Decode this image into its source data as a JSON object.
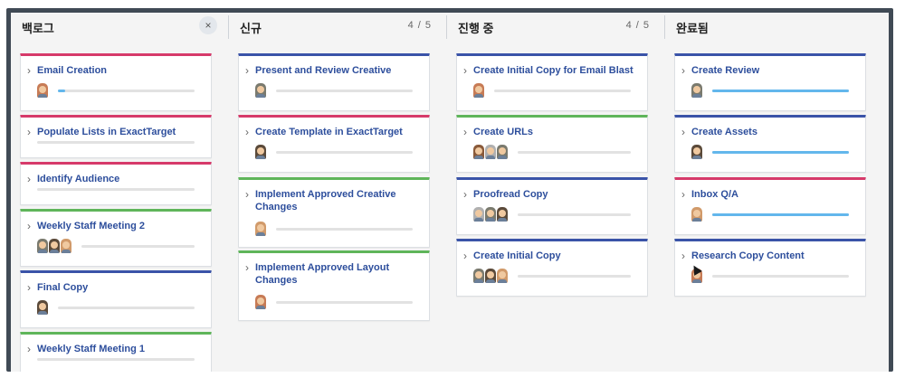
{
  "colors": {
    "pink": "#d63a6a",
    "blue": "#3a53a8",
    "green": "#5fb55a",
    "progress_fill": "#63b7ec",
    "title_text": "#2d4e9c"
  },
  "columns": [
    {
      "title": "백로그",
      "count": "",
      "close_icon": "×",
      "cards": [
        {
          "title": "Email Creation",
          "color": "pink",
          "avatars": [
            "person"
          ],
          "progress": 0.05
        },
        {
          "title": "Populate Lists in ExactTarget",
          "color": "pink",
          "avatars": [],
          "progress": 0
        },
        {
          "title": "Identify Audience",
          "color": "pink",
          "avatars": [],
          "progress": 0
        },
        {
          "title": "Weekly Staff Meeting 2",
          "color": "green",
          "avatars": [
            "person",
            "person",
            "person"
          ],
          "progress": 0
        },
        {
          "title": "Final Copy",
          "color": "blue",
          "avatars": [
            "person"
          ],
          "progress": 0
        },
        {
          "title": "Weekly Staff Meeting 1",
          "color": "green",
          "avatars": [],
          "progress": 0
        }
      ]
    },
    {
      "title": "신규",
      "count": "4 / 5",
      "cards": [
        {
          "title": "Present and Review Creative",
          "color": "blue",
          "avatars": [
            "person"
          ],
          "progress": 0
        },
        {
          "title": "Create Template in ExactTarget",
          "color": "pink",
          "avatars": [
            "person"
          ],
          "progress": 0
        },
        {
          "title": "Implement Approved Creative Changes",
          "color": "green",
          "avatars": [
            "person"
          ],
          "progress": 0
        },
        {
          "title": "Implement Approved Layout Changes",
          "color": "green",
          "avatars": [
            "person"
          ],
          "progress": 0
        }
      ]
    },
    {
      "title": "진행 중",
      "count": "4 / 5",
      "cards": [
        {
          "title": "Create Initial Copy for Email Blast",
          "color": "blue",
          "avatars": [
            "person"
          ],
          "progress": 0
        },
        {
          "title": "Create URLs",
          "color": "green",
          "avatars": [
            "person",
            "person",
            "person"
          ],
          "progress": 0
        },
        {
          "title": "Proofread Copy",
          "color": "blue",
          "avatars": [
            "person",
            "person",
            "person"
          ],
          "progress": 0
        },
        {
          "title": "Create Initial Copy",
          "color": "blue",
          "avatars": [
            "person",
            "person",
            "person"
          ],
          "progress": 0
        }
      ]
    },
    {
      "title": "완료됨",
      "count": "",
      "cards": [
        {
          "title": "Create Review",
          "color": "blue",
          "avatars": [
            "person"
          ],
          "progress": 1
        },
        {
          "title": "Create Assets",
          "color": "blue",
          "avatars": [
            "person"
          ],
          "progress": 1
        },
        {
          "title": "Inbox Q/A",
          "color": "pink",
          "avatars": [
            "person"
          ],
          "progress": 1
        },
        {
          "title": "Research Copy Content",
          "color": "blue",
          "avatars": [
            "person"
          ],
          "progress": 0
        }
      ]
    }
  ]
}
